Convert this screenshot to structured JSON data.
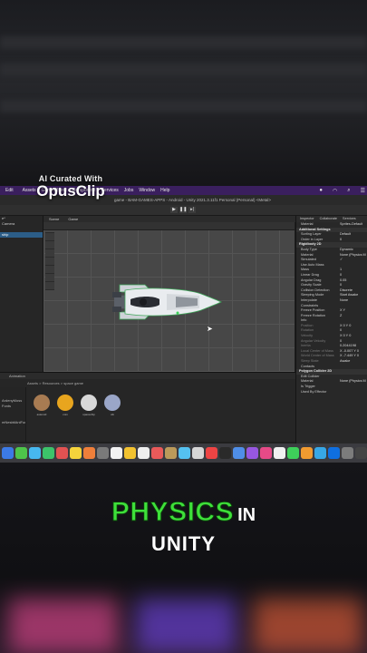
{
  "watermark": {
    "line1": "AI Curated With",
    "line2": "OpusClip"
  },
  "menubar": {
    "items": [
      "Edit",
      "Assets",
      "GameObject",
      "Component",
      "Services",
      "Jobs",
      "Window",
      "Help"
    ],
    "right_icons": [
      "record-icon",
      "wifi-icon",
      "search-icon",
      "control-center-icon"
    ]
  },
  "titlebar": {
    "text": "game - BAM-GAMES-APPS - Android - Unity 2021.3.11f1 Personal (Personal) <Metal>"
  },
  "hierarchy": {
    "rows": [
      "e*",
      "Camera",
      "",
      "ship"
    ]
  },
  "scene": {
    "tabs": [
      "Scene",
      "Game"
    ]
  },
  "inspector": {
    "tabs": [
      "Inspector",
      "Collaborate",
      "Services"
    ],
    "rows": [
      {
        "label": "Material",
        "value": "Sprites-Default"
      },
      {
        "label": "Additional Settings",
        "value": "",
        "head": true
      },
      {
        "label": "Sorting Layer",
        "value": "Default"
      },
      {
        "label": "Order in Layer",
        "value": "0"
      },
      {
        "label": "Rigidbody 2D",
        "value": "",
        "head": true
      },
      {
        "label": "Body Type",
        "value": "Dynamic"
      },
      {
        "label": "Material",
        "value": "None (Physics M"
      },
      {
        "label": "Simulated",
        "value": "✓"
      },
      {
        "label": "Use Auto Mass",
        "value": ""
      },
      {
        "label": "Mass",
        "value": "1"
      },
      {
        "label": "Linear Drag",
        "value": "0"
      },
      {
        "label": "Angular Drag",
        "value": "0.05"
      },
      {
        "label": "Gravity Scale",
        "value": "0"
      },
      {
        "label": "Collision Detection",
        "value": "Discrete"
      },
      {
        "label": "Sleeping Mode",
        "value": "Start Awake"
      },
      {
        "label": "Interpolate",
        "value": "None"
      },
      {
        "label": "Constraints",
        "value": ""
      },
      {
        "label": "Freeze Position",
        "value": "X  Y"
      },
      {
        "label": "Freeze Rotation",
        "value": "Z"
      },
      {
        "label": "Info",
        "value": ""
      },
      {
        "label": "Position",
        "value": "X 0  Y 0",
        "dim": true
      },
      {
        "label": "Rotation",
        "value": "0",
        "dim": true
      },
      {
        "label": "Velocity",
        "value": "X 0  Y 0",
        "dim": true
      },
      {
        "label": "Angular Velocity",
        "value": "0",
        "dim": true
      },
      {
        "label": "Inertia",
        "value": "0.2044198",
        "dim": true
      },
      {
        "label": "Local Center of Mass",
        "value": "X -0.007  Y 0",
        "dim": true
      },
      {
        "label": "World Center of Mass",
        "value": "X -7.449  Y 0",
        "dim": true
      },
      {
        "label": "Sleep State",
        "value": "Awake",
        "dim": true
      },
      {
        "label": "Contacts",
        "value": ""
      },
      {
        "label": "Polygon Collider 2D",
        "value": "",
        "head": true
      },
      {
        "label": "Edit Collider",
        "value": ""
      },
      {
        "label": "Material",
        "value": "None (Physics M"
      },
      {
        "label": "Is Trigger",
        "value": ""
      },
      {
        "label": "Used By Effector",
        "value": ""
      }
    ]
  },
  "project": {
    "tab": "Animation",
    "breadcrumb": "Assets > Resources > space game",
    "tree": [
      "",
      "",
      "ArdenyMoss",
      "Fonts",
      "",
      "",
      "mNesbitAniFun",
      "",
      "",
      ""
    ],
    "assets": [
      {
        "label": "asteroid",
        "icon": "asteroid-icon",
        "color": "#a87b52"
      },
      {
        "label": "coin",
        "icon": "coin-icon",
        "color": "#e8a51e"
      },
      {
        "label": "spaceship",
        "icon": "spaceship-icon",
        "color": "#d8d8d8"
      },
      {
        "label": "ufo",
        "icon": "ufo-icon",
        "color": "#9aa6c8"
      }
    ]
  },
  "dock": {
    "colors": [
      "#3c7ae6",
      "#4ec44a",
      "#47b8f0",
      "#3cc36a",
      "#e25252",
      "#f5d33c",
      "#ef7f3a",
      "#7a7a7a",
      "#f2f2f2",
      "#f2c230",
      "#eeeeee",
      "#e95a5a",
      "#bb9a5a",
      "#55c1f0",
      "#d6d6d6",
      "#ee4444",
      "#2a2a2a",
      "#4f8ee8",
      "#9757e0",
      "#e64a87",
      "#f0f0f0",
      "#3ecf5a",
      "#f19b30",
      "#37a7e6",
      "#0f6fe0",
      "#7c7c7c",
      "#444",
      "#6fb5ef",
      "#9a6df0",
      "#2b2b2b",
      "#d7d7d7"
    ]
  },
  "caption": {
    "word1": "PHYSICS",
    "word2": "IN",
    "line2": "UNITY"
  },
  "colors": {
    "caption_green": "#3ee03a",
    "menubar": "#3a1f5e",
    "selection": "#2c5d87"
  }
}
